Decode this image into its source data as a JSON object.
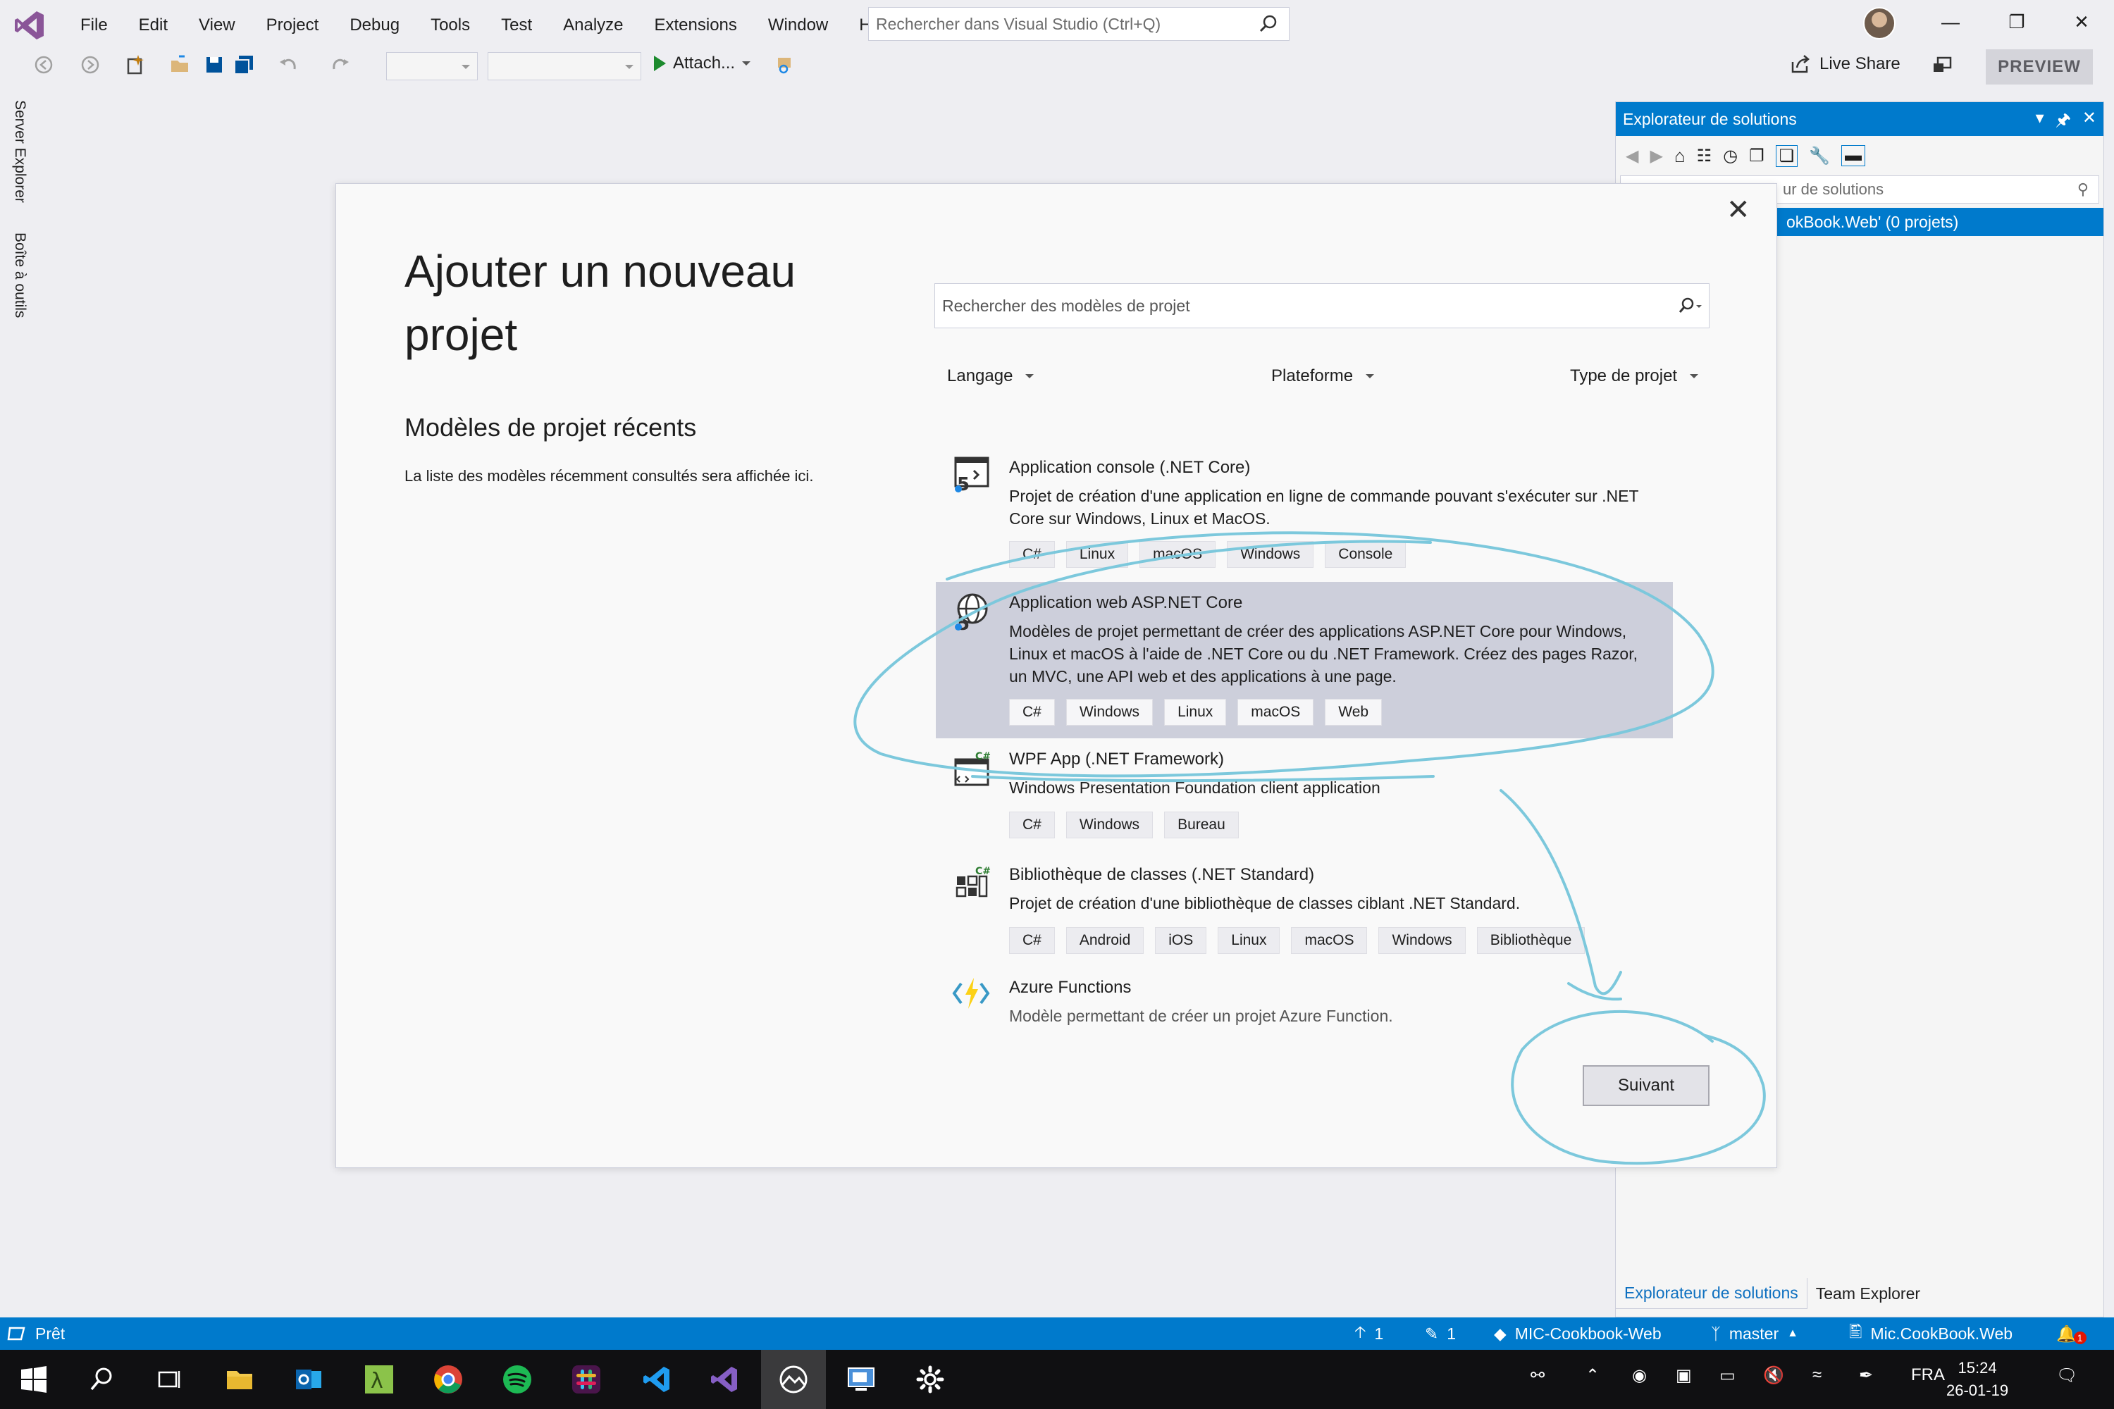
{
  "menu": {
    "items": [
      "File",
      "Edit",
      "View",
      "Project",
      "Debug",
      "Tools",
      "Test",
      "Analyze",
      "Extensions",
      "Window",
      "Help"
    ],
    "search_placeholder": "Rechercher dans Visual Studio (Ctrl+Q)"
  },
  "toolbar": {
    "attach_label": "Attach...",
    "live_share_label": "Live Share",
    "preview_label": "PREVIEW"
  },
  "side_tabs": {
    "server_explorer": "Server Explorer",
    "toolbox": "Boîte à outils"
  },
  "solution_explorer": {
    "title": "Explorateur de solutions",
    "search_text": "ur de solutions",
    "selected_item": "okBook.Web' (0 projets)",
    "tabs": [
      "Explorateur de solutions",
      "Team Explorer"
    ]
  },
  "dialog": {
    "title": "Ajouter un nouveau projet",
    "recent_heading": "Modèles de projet récents",
    "recent_desc": "La liste des modèles récemment consultés sera affichée ici.",
    "search_placeholder": "Rechercher des modèles de projet",
    "filters": {
      "language": "Langage",
      "platform": "Plateforme",
      "project_type": "Type de projet"
    },
    "templates": [
      {
        "name": "Application console (.NET Core)",
        "desc": "Projet de création d'une application en ligne de commande pouvant s'exécuter sur .NET Core sur Windows, Linux et MacOS.",
        "tags": [
          "C#",
          "Linux",
          "macOS",
          "Windows",
          "Console"
        ],
        "icon": "console-icon"
      },
      {
        "name": "Application web ASP.NET Core",
        "desc": "Modèles de projet permettant de créer des applications ASP.NET Core pour Windows, Linux et macOS à l'aide de .NET Core ou du .NET Framework. Créez des pages Razor, un MVC, une API web et des applications à une page.",
        "tags": [
          "C#",
          "Windows",
          "Linux",
          "macOS",
          "Web"
        ],
        "icon": "web-globe-icon",
        "selected": true
      },
      {
        "name": "WPF App (.NET Framework)",
        "desc": "Windows Presentation Foundation client application",
        "tags": [
          "C#",
          "Windows",
          "Bureau"
        ],
        "icon": "wpf-window-icon"
      },
      {
        "name": "Bibliothèque de classes (.NET Standard)",
        "desc": "Projet de création d'une bibliothèque de classes ciblant .NET Standard.",
        "tags": [
          "C#",
          "Android",
          "iOS",
          "Linux",
          "macOS",
          "Windows",
          "Bibliothèque"
        ],
        "icon": "class-library-icon"
      },
      {
        "name": "Azure Functions",
        "desc": "Modèle permettant de créer un projet Azure Function.",
        "tags": [],
        "icon": "azure-functions-icon"
      }
    ],
    "next_label": "Suivant"
  },
  "statusbar": {
    "ready": "Prêt",
    "up_count": "1",
    "edit_count": "1",
    "repo": "MIC-Cookbook-Web",
    "branch": "master",
    "project": "Mic.CookBook.Web",
    "notification_count": "1"
  },
  "taskbar": {
    "language": "FRA",
    "time": "15:24",
    "date": "26-01-19"
  },
  "colors": {
    "accent": "#007acc",
    "annotation": "#7cc8dc",
    "selected_row": "#cdcfdb"
  }
}
